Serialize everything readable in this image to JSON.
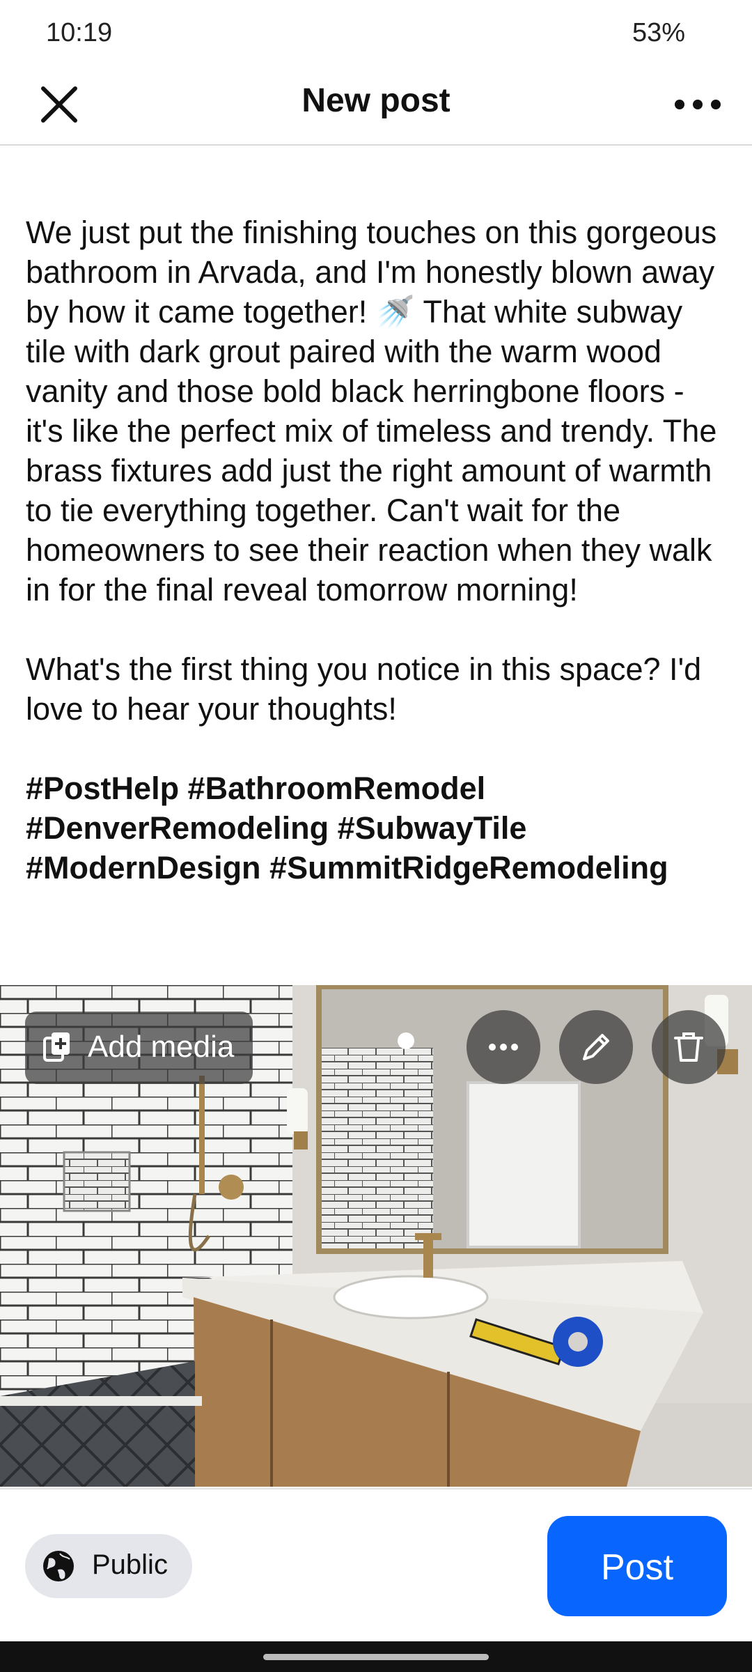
{
  "status_bar": {
    "time": "10:19",
    "battery": "53%"
  },
  "header": {
    "title": "New post",
    "close_icon": "close-icon",
    "more_icon": "more-horizontal-icon"
  },
  "post": {
    "paragraph1": "We just put the finishing touches on this gorgeous bathroom in Arvada, and I'm honestly blown away by how it came together! 🚿 That white subway tile with dark grout paired with the warm wood vanity and those bold black herringbone floors - it's like the perfect mix of timeless and trendy. The brass fixtures add just the right amount of warmth to tie everything together. Can't wait for the homeowners to see their reaction when they walk in for the final reveal tomorrow morning!",
    "paragraph2": "What's the first thing you notice in this space? I'd love to hear your thoughts!",
    "hashtags": "#PostHelp #BathroomRemodel #DenverRemodeling #SubwayTile #ModernDesign #SummitRidgeRemodeling"
  },
  "media": {
    "add_media_label": "Add media",
    "actions": [
      "more-horizontal-icon",
      "pencil-icon",
      "trash-icon"
    ]
  },
  "footer": {
    "audience_label": "Public",
    "audience_icon": "globe-icon",
    "post_label": "Post",
    "post_color": "#0866ff"
  }
}
